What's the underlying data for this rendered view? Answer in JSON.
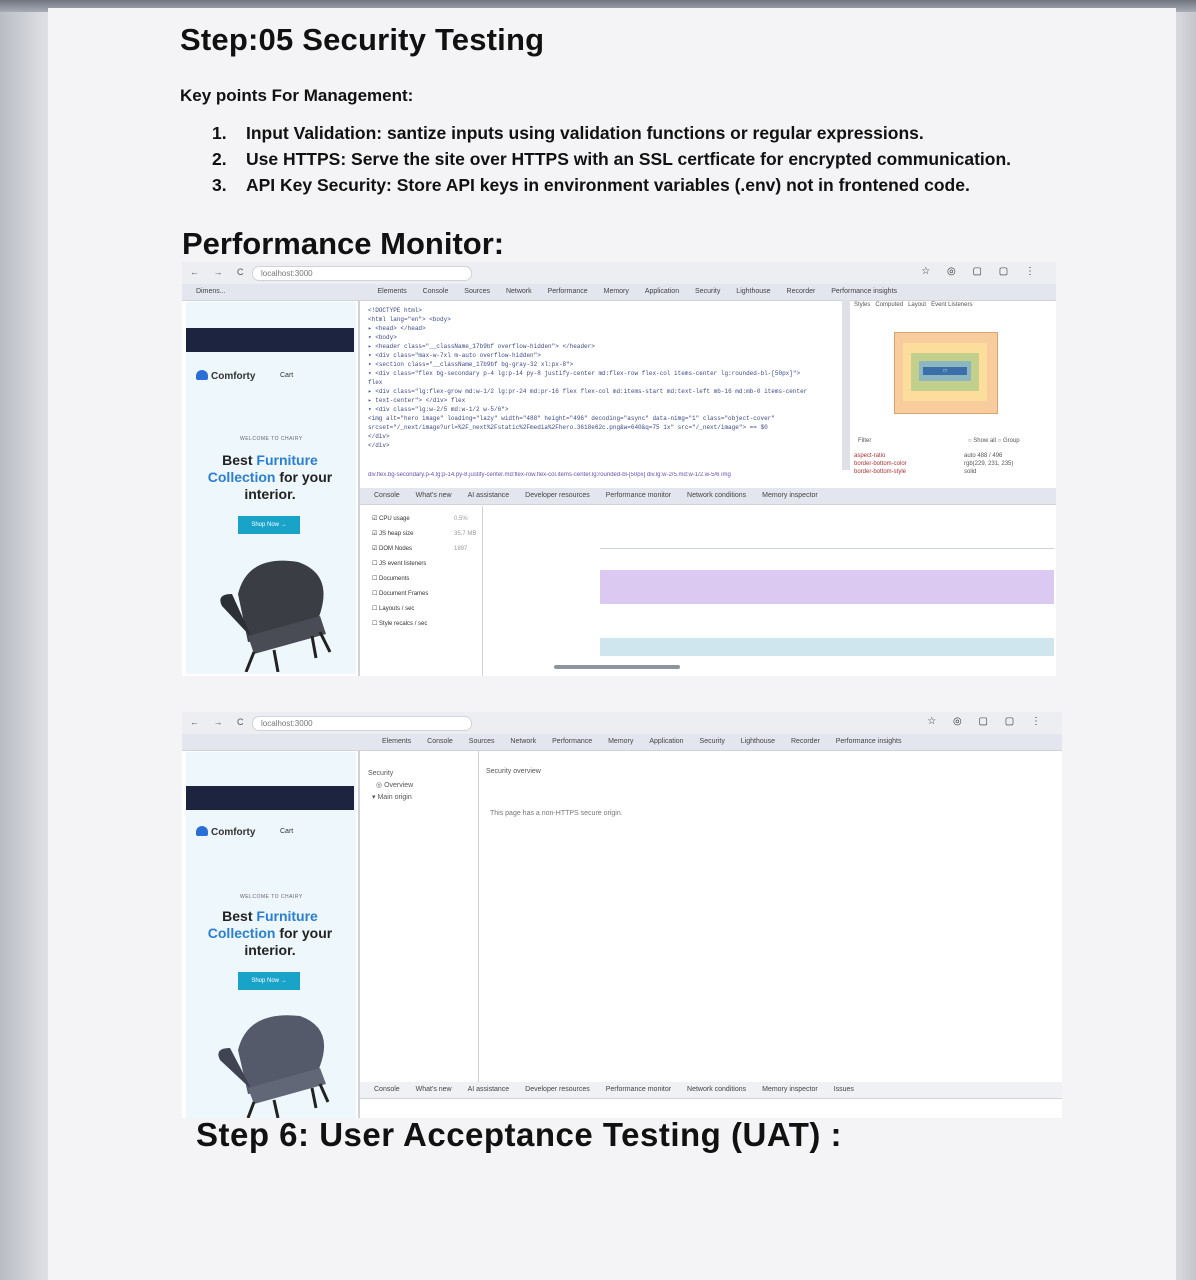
{
  "document": {
    "step5_heading": "Step:05 Security Testing",
    "key_points_heading": "Key points For Management:",
    "key_points": [
      {
        "num": "1.",
        "text": "Input Validation: santize inputs using validation functions or regular expressions."
      },
      {
        "num": "2.",
        "text": "Use HTTPS: Serve the site over HTTPS with an SSL certficate for encrypted communication."
      },
      {
        "num": "3.",
        "text": "API Key Security: Store API keys in environment variables (.env) not in frontened code."
      }
    ],
    "performance_heading": "Performance Monitor:",
    "step6_heading": "Step 6: User Acceptance Testing (UAT) :"
  },
  "screenshot1": {
    "url": "localhost:3000",
    "device": "Dimens...",
    "devtools_tabs": [
      "Elements",
      "Console",
      "Sources",
      "Network",
      "Performance",
      "Memory",
      "Application",
      "Security",
      "Lighthouse",
      "Recorder",
      "Performance insights"
    ],
    "site": {
      "brand": "Comforty",
      "cart": "Cart",
      "welcome": "WELCOME TO CHAIRY",
      "hero_part1": "Best ",
      "hero_part2": "Furniture",
      "hero_part3": "Collection",
      "hero_part4": " for your interior.",
      "shop_button": "Shop Now →"
    },
    "code_lines": [
      "<!DOCTYPE html>",
      "<html lang=\"en\"> <body>",
      "▸ <head> </head>",
      "▾ <body>",
      "  ▸ <header class=\"__className_17b9bf overflow-hidden\"> </header>",
      "  ▾ <div class=\"max-w-7xl m-auto overflow-hidden\">",
      "    ▾ <section class=\"__className_17b9bf bg-gray-32 xl:px-8\">",
      "      ▾ <div class=\"flex bg-secondary p-4 lg:p-14 py-8 justify-center md:flex-row flex-col items-center lg:rounded-bl-[50px]\">",
      "          flex",
      "        ▸ <div class=\"lg:flex-grow md:w-1/2 lg:pr-24 md:pr-16 flex flex-col md:items-start md:text-left mb-16 md:mb-0 items-center",
      "          ▸ text-center\"> </div> flex",
      "        ▾ <div class=\"lg:w-2/5 md:w-1/2 w-5/6\">",
      "            <img alt=\"hero image\" loading=\"lazy\" width=\"488\" height=\"496\" decoding=\"async\" data-nimg=\"1\" class=\"object-cover\"",
      "            srcset=\"/_next/image?url=%2F_next%2Fstatic%2Fmedia%2Fhero.3618e62c.png&w=640&q=75 1x\" src=\"/_next/image\"> == $0",
      "          </div>",
      "        </div>"
    ],
    "breadcrumb": "div.flex.bg-secondary.p-4.lg:p-14.py-8.justify-center.md:flex-row.flex-col.items-center.lg:rounded-bl-[50px]   div.lg:w-2/5.md:w-1/2.w-5/6   img",
    "styles_tabs": [
      "Styles",
      "Computed",
      "Layout",
      "Event Listeners"
    ],
    "filter_label": "Filter",
    "show_all": "Show all",
    "group": "Group",
    "style_props": [
      "aspect-ratio",
      "border-bottom-color",
      "border-bottom-style"
    ],
    "style_values": [
      "auto 488 / 496",
      "rgb(229, 231, 235)",
      "solid"
    ],
    "drawer_tabs": [
      "Console",
      "What's new",
      "AI assistance",
      "Developer resources",
      "Performance monitor",
      "Network conditions",
      "Memory inspector"
    ],
    "monitor_items": [
      {
        "label": "CPU usage",
        "checked": true
      },
      {
        "label": "JS heap size",
        "checked": true
      },
      {
        "label": "DOM Nodes",
        "checked": true
      },
      {
        "label": "JS event listeners",
        "checked": false
      },
      {
        "label": "Documents",
        "checked": false
      },
      {
        "label": "Document Frames",
        "checked": false
      },
      {
        "label": "Layouts / sec",
        "checked": false
      },
      {
        "label": "Style recalcs / sec",
        "checked": false
      }
    ],
    "monitor_values": [
      "0.5%",
      "35.7 MB",
      "1897"
    ]
  },
  "screenshot2": {
    "url": "localhost:3000",
    "devtools_tabs": [
      "Elements",
      "Console",
      "Sources",
      "Network",
      "Performance",
      "Memory",
      "Application",
      "Security",
      "Lighthouse",
      "Recorder",
      "Performance insights"
    ],
    "security_label": "Security",
    "overview_label": "Overview",
    "main_origin": "Main origin",
    "security_overview": "Security overview",
    "non_https_message": "This page has a non-HTTPS secure origin.",
    "site": {
      "brand": "Comforty",
      "cart": "Cart",
      "welcome": "WELCOME TO CHAIRY",
      "hero_part1": "Best ",
      "hero_part2": "Furniture",
      "hero_part3": "Collection",
      "hero_part4": " for your interior.",
      "shop_button": "Shop Now →"
    },
    "drawer_tabs": [
      "Console",
      "What's new",
      "AI assistance",
      "Developer resources",
      "Performance monitor",
      "Network conditions",
      "Memory inspector",
      "Issues"
    ]
  },
  "colors": {
    "brand_blue": "#2a7fd4",
    "shop_button": "#1aa3c9",
    "promo_bar": "#1c2440",
    "perf_purple": "#dcc9f2"
  }
}
